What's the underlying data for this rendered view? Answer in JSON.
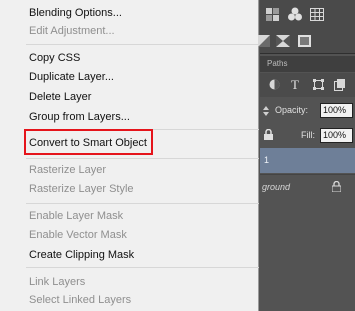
{
  "context_menu": {
    "items": [
      {
        "label": "Blending Options...",
        "enabled": true
      },
      {
        "label": "Edit Adjustment...",
        "enabled": false
      },
      {
        "label": "Copy CSS",
        "enabled": true
      },
      {
        "label": "Duplicate Layer...",
        "enabled": true
      },
      {
        "label": "Delete Layer",
        "enabled": true
      },
      {
        "label": "Group from Layers...",
        "enabled": true
      },
      {
        "label": "Convert to Smart Object",
        "enabled": true,
        "highlighted": true
      },
      {
        "label": "Rasterize Layer",
        "enabled": false
      },
      {
        "label": "Rasterize Layer Style",
        "enabled": false
      },
      {
        "label": "Enable Layer Mask",
        "enabled": false
      },
      {
        "label": "Enable Vector Mask",
        "enabled": false
      },
      {
        "label": "Create Clipping Mask",
        "enabled": true
      },
      {
        "label": "Link Layers",
        "enabled": false
      },
      {
        "label": "Select Linked Layers",
        "enabled": false
      }
    ],
    "highlight_color": "#e5141b"
  },
  "panel": {
    "tab_label": "Paths",
    "opacity_label": "Opacity:",
    "opacity_value": "100%",
    "fill_label": "Fill:",
    "fill_value": "100%",
    "selected_layer_name": "1",
    "background_layer_name": "ground",
    "icons": [
      "adjustments-icon",
      "styles-icon",
      "grid-icon",
      "image-icon",
      "mask-icon",
      "swatch-icon",
      "pixel-filter-icon",
      "type-filter-icon",
      "shape-filter-icon",
      "smart-object-filter-icon",
      "lock-icon",
      "lock-icon"
    ]
  }
}
